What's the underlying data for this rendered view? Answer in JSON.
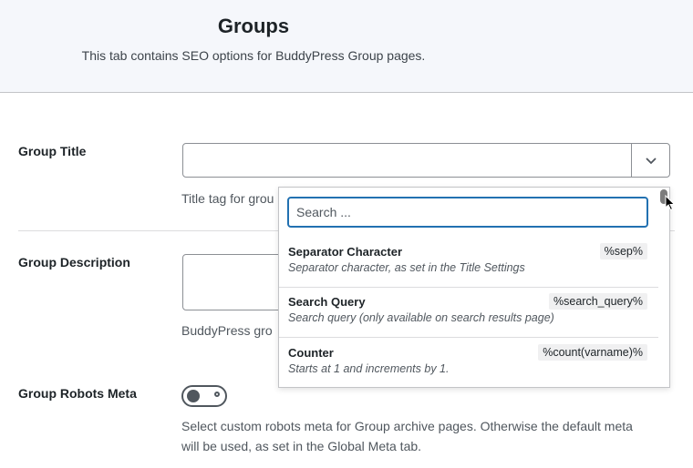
{
  "header": {
    "title": "Groups",
    "subtitle": "This tab contains SEO options for BuddyPress Group pages."
  },
  "fields": {
    "group_title": {
      "label": "Group Title",
      "help": "Title tag for grou"
    },
    "group_description": {
      "label": "Group Description",
      "help": "BuddyPress gro"
    },
    "group_robots_meta": {
      "label": "Group Robots Meta",
      "help_line1": "Select custom robots meta for Group archive pages. Otherwise the default meta",
      "help_line2": "will be used, as set in the Global Meta tab.",
      "enabled": false
    }
  },
  "dropdown": {
    "search_placeholder": "Search ...",
    "search_value": "",
    "items": [
      {
        "name": "Separator Character",
        "description": "Separator character, as set in the Title Settings",
        "tag": "%sep%"
      },
      {
        "name": "Search Query",
        "description": "Search query (only available on search results page)",
        "tag": "%search_query%"
      },
      {
        "name": "Counter",
        "description": "Starts at 1 and increments by 1.",
        "tag": "%count(varname)%"
      }
    ]
  },
  "icons": {
    "select_arrow": "chevron-down-icon",
    "cursor": "mouse-pointer-icon"
  },
  "colors": {
    "accent": "#2271b1",
    "header_bg": "#f5f7fb",
    "text": "#1d2327"
  }
}
